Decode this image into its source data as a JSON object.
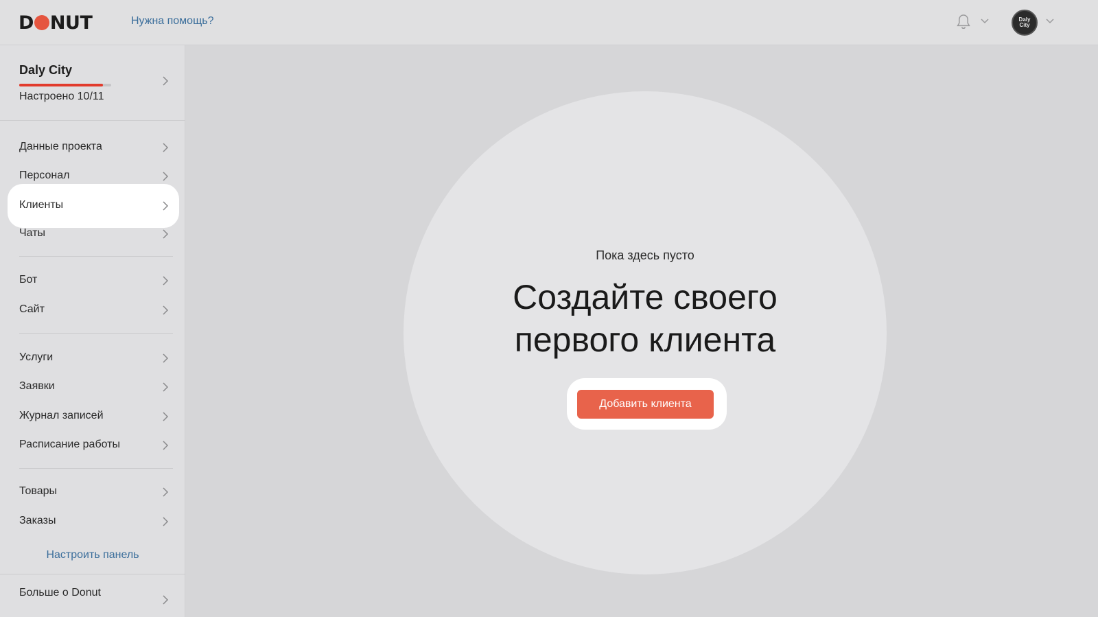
{
  "header": {
    "logo_text": "DONUT",
    "help_link": "Нужна помощь?",
    "avatar_text": "Daly City"
  },
  "sidebar": {
    "project": {
      "name": "Daly City",
      "status": "Настроено 10/11",
      "progress": 0.909
    },
    "items": [
      {
        "label": "Данные проекта"
      },
      {
        "label": "Персонал"
      },
      {
        "label": "Клиенты",
        "active": true
      },
      {
        "label": "Чаты"
      },
      {
        "label": "Бот"
      },
      {
        "label": "Сайт"
      },
      {
        "label": "Услуги"
      },
      {
        "label": "Заявки"
      },
      {
        "label": "Журнал записей"
      },
      {
        "label": "Расписание работы"
      },
      {
        "label": "Товары"
      },
      {
        "label": "Заказы"
      }
    ],
    "customize_label": "Настроить панель",
    "more_label": "Больше о Donut"
  },
  "main": {
    "empty_subtitle": "Пока здесь пусто",
    "empty_title_line1": "Создайте своего",
    "empty_title_line2": "первого клиента",
    "add_button_label": "Добавить клиента"
  },
  "colors": {
    "accent": "#e8634b",
    "link": "#3b6e9b",
    "progress": "#e23b2c"
  },
  "icons": [
    "bell-icon",
    "chevron-down-icon",
    "chevron-right-icon"
  ]
}
